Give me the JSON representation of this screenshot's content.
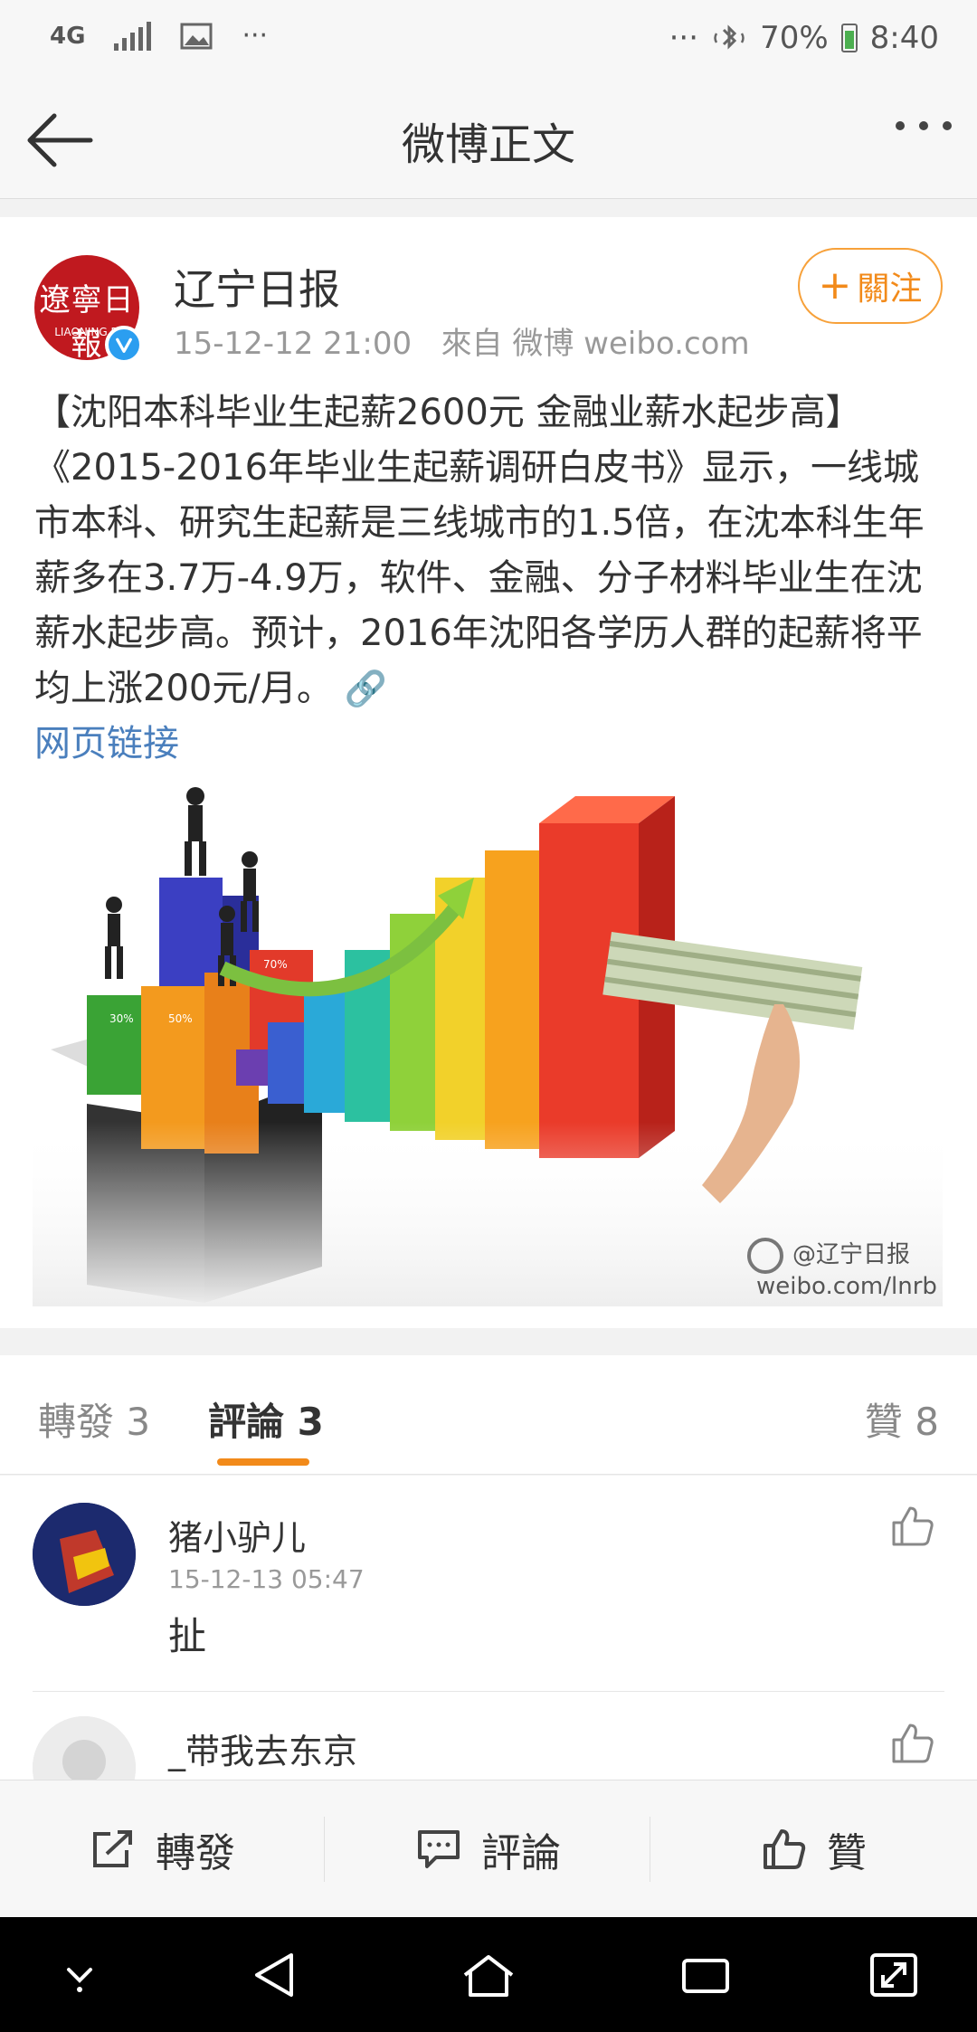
{
  "status_bar": {
    "network": "4G",
    "more_left": "···",
    "more_right": "···",
    "battery": "70%",
    "time": "8:40"
  },
  "nav": {
    "title": "微博正文"
  },
  "post": {
    "author": "辽宁日报",
    "avatar_text": "遼寧日報",
    "avatar_sub": "LIAONING D",
    "timestamp": "15-12-12 21:00",
    "source": "來自 微博 weibo.com",
    "follow_label": "關注",
    "body": "【沈阳本科毕业生起薪2600元 金融业薪水起步高】《2015-2016年毕业生起薪调研白皮书》显示，一线城市本科、研究生起薪是三线城市的1.5倍，在沈本科生年薪多在3.7万-4.9万，软件、金融、分子材料毕业生在沈薪水起步高。预计，2016年沈阳各学历人群的起薪将平均上涨200元/月。",
    "link_label": "网页链接",
    "image": {
      "bar_labels": [
        "30%",
        "50%",
        "70%"
      ],
      "watermark_handle": "@辽宁日报",
      "watermark_url": "weibo.com/lnrb"
    }
  },
  "tabs": {
    "reposts": "轉發 3",
    "comments": "評論 3",
    "likes": "贊 8"
  },
  "comments": [
    {
      "name": "猪小驴儿",
      "time": "15-12-13 05:47",
      "text": "扯"
    },
    {
      "name": "_带我去东京",
      "time": "",
      "text": ""
    }
  ],
  "actions": {
    "repost": "轉發",
    "comment": "評論",
    "like": "贊"
  },
  "colors": {
    "accent": "#f28a1a",
    "link": "#4a7fbd",
    "verified": "#2b9ef0",
    "brand_red": "#c0191f"
  }
}
